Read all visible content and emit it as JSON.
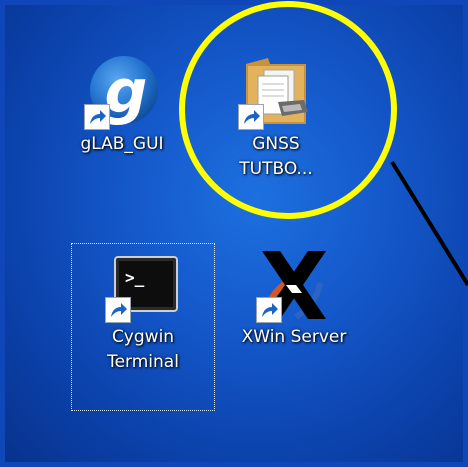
{
  "desktop": {
    "icons": [
      {
        "label": "gLAB_GUI",
        "icon": "glab-g-icon",
        "color": "#2e7bd6"
      },
      {
        "label_lines": [
          "GNSS",
          "TUTBO..."
        ],
        "icon": "folder-with-documents-icon",
        "color": "#e2b45a"
      },
      {
        "label_lines": [
          "Cygwin",
          "Terminal"
        ],
        "icon": "terminal-icon",
        "color": "#1c1c1c"
      },
      {
        "label": "XWin Server",
        "icon": "x-window-icon",
        "color": "#000000"
      }
    ],
    "background_color": "#1457c9",
    "highlight_circle_color": "#ffff00"
  }
}
